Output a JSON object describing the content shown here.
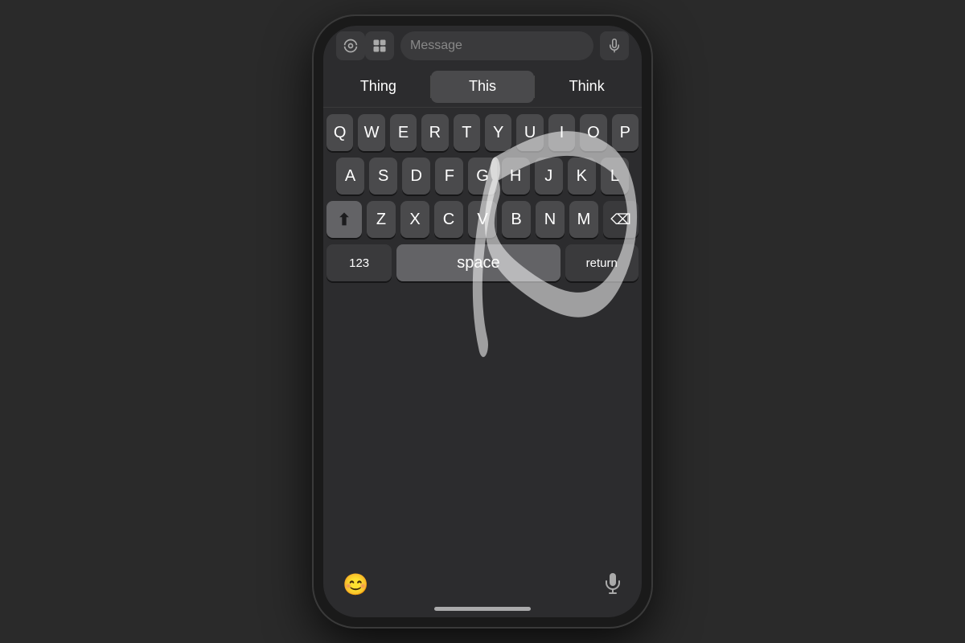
{
  "phone": {
    "message_placeholder": "Message",
    "autocorrect": {
      "left": "Thing",
      "center": "This",
      "right": "Think"
    },
    "keyboard": {
      "row1": [
        "Q",
        "W",
        "E",
        "R",
        "T",
        "Y",
        "U",
        "I",
        "O",
        "P"
      ],
      "row2": [
        "A",
        "S",
        "D",
        "F",
        "G",
        "H",
        "J",
        "K",
        "L"
      ],
      "row3": [
        "Z",
        "X",
        "C",
        "V",
        "B",
        "N",
        "M"
      ],
      "space_label": "space",
      "numbers_label": "123",
      "return_label": "return"
    },
    "bottom": {
      "emoji_label": "😊",
      "mic_label": "🎤"
    }
  }
}
